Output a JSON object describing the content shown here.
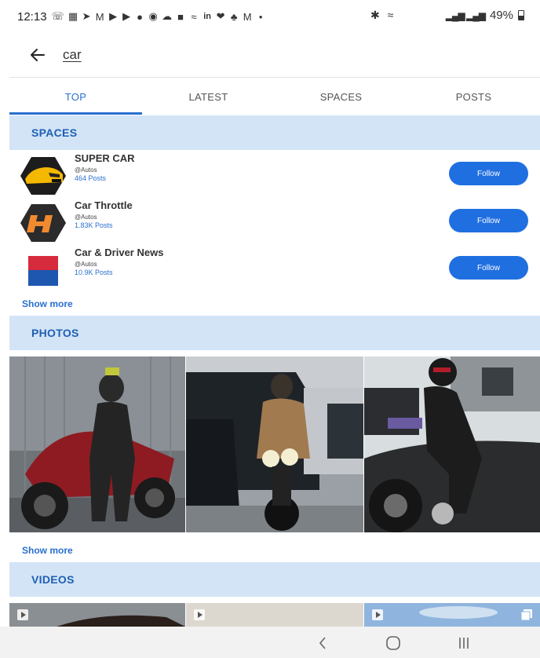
{
  "status_bar": {
    "time": "12:13",
    "battery": "49%",
    "notification_icons": [
      "whatsapp-icon",
      "news-icon",
      "telegram-icon",
      "gmail-icon",
      "youtube-icon",
      "youtube-icon",
      "browser-icon",
      "pay-icon",
      "cloud-icon",
      "app-icon",
      "photos-icon",
      "linkedin-icon",
      "twitter-icon",
      "app-icon",
      "gmail-icon",
      "more-dot-icon"
    ]
  },
  "search": {
    "query": "car"
  },
  "tabs": [
    {
      "label": "TOP",
      "active": true
    },
    {
      "label": "LATEST",
      "active": false
    },
    {
      "label": "SPACES",
      "active": false
    },
    {
      "label": "POSTS",
      "active": false
    }
  ],
  "sections": {
    "spaces": {
      "title": "SPACES",
      "show_more": "Show more",
      "items": [
        {
          "name": "SUPER CAR",
          "handle": "@Autos",
          "posts": "464 Posts",
          "follow_label": "Follow"
        },
        {
          "name": "Car Throttle",
          "handle": "@Autos",
          "posts": "1.83K Posts",
          "follow_label": "Follow"
        },
        {
          "name": "Car & Driver News",
          "handle": "@Autos",
          "posts": "10.9K Posts",
          "follow_label": "Follow"
        }
      ]
    },
    "photos": {
      "title": "PHOTOS",
      "show_more": "Show more"
    },
    "videos": {
      "title": "VIDEOS"
    }
  },
  "colors": {
    "accent": "#1f6fe0",
    "section_bg": "#d3e4f7",
    "section_text": "#1f5fb3"
  }
}
